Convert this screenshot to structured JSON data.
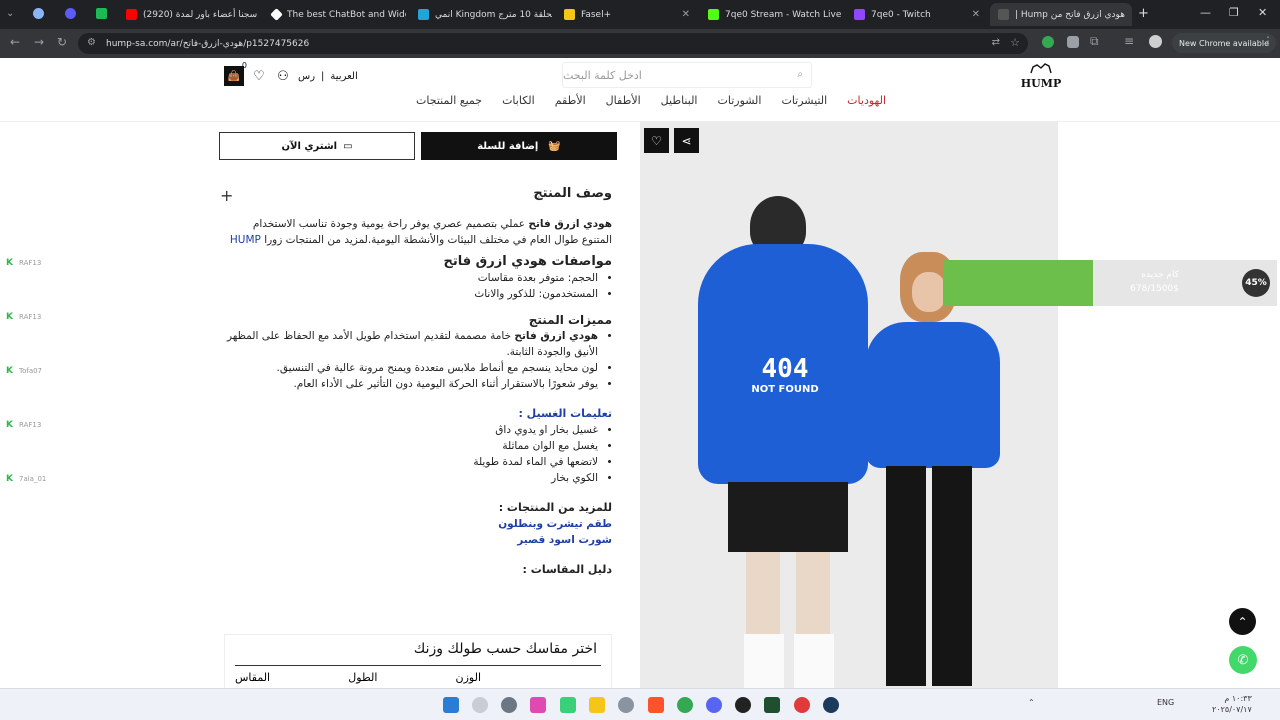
{
  "browser": {
    "tabs": [
      {
        "title": "(2920) سجنا أعضاء باور لمدة",
        "color": "#ff0000"
      },
      {
        "title": "The best ChatBot and Widg",
        "color": "#ffffff"
      },
      {
        "title": "انمي Kingdom الحلقة 10 مترج",
        "color": "#24a3d9"
      },
      {
        "title": "Fasel+",
        "color": "#f5c518"
      },
      {
        "title": "7qe0 Stream - Watch Live o",
        "color": "#53fc18"
      },
      {
        "title": "7qe0 - Twitch",
        "color": "#9146ff"
      },
      {
        "title": "هودي ازرق فاتح من Hump |",
        "color": "#555555"
      }
    ],
    "url": "hump-sa.com/ar/هودي-ازرق-فاتح/p1527475626",
    "new_chrome": "New Chrome available"
  },
  "store": {
    "logo": "HUMP",
    "search_placeholder": "ادخل كلمة البحث",
    "cart_count": "0",
    "lang": "العربية",
    "currency": "رس",
    "menu": [
      "الهوديات",
      "التيشرتات",
      "الشورتات",
      "البناطيل",
      "الأطفال",
      "الأطقم",
      "الكابات",
      "جميع المنتجات"
    ],
    "buy_now": "اشتري الآن",
    "add_to_cart": "إضافة للسلة"
  },
  "product": {
    "print_title": "404",
    "print_sub": "NOT FOUND",
    "desc_title": "وصف المنتج",
    "intro_bold": "هودي ازرق فاتح",
    "intro_rest": " عملي بتصميم عصري يوفر راحة يومية وجودة تناسب الاستخدام المتنوع طوال العام في مختلف البيئات والأنشطة اليومية.لمزيد من المنتجات زورا ",
    "intro_link": "HUMP",
    "specs_title": "مواصفات هودي ازرق فاتح",
    "specs": [
      "الحجم: متوفر بعدة مقاسات",
      "المستخدمون: للذكور والاناث"
    ],
    "features_title": "مميزات المنتج",
    "features_first_bold": "هودي ازرق فاتح",
    "features_first_rest": " خامة مصممة لتقديم استخدام طويل الأمد مع الحفاظ على المظهر الأنيق والجودة الثابتة.",
    "features": [
      "لون محايد ينسجم مع أنماط ملابس متعددة ويمنح مرونة عالية في التنسيق.",
      "يوفر شعورًا بالاستقرار أثناء الحركة اليومية دون التأثير على الأداء العام."
    ],
    "wash_title": "تعليمات الغسيل :",
    "wash": [
      "غسيل بخار او يدوي داڨ",
      "يغسل مع الوان مماثلة",
      "لاتضعها في الماء لمدة طويلة",
      "الكوي بخار"
    ],
    "more_title": "للمزيد من المنتجات :",
    "more_links": [
      "طقم تيشرت وبنطلون",
      "شورت اسود قصير"
    ],
    "size_guide": "دليل المقاسات :",
    "size_box_title": "اختر مقاسك حسب طولك وزنك",
    "size_cols": [
      "الوزن",
      "الطول",
      "المقاس"
    ]
  },
  "promo": {
    "title": "كام جديده",
    "progress": "678/1500$",
    "percent": "45%",
    "fill": 0.45
  },
  "sidebar": [
    "RAF13",
    "RAF13",
    "Tofa07",
    "RAF13",
    "7ala_01"
  ],
  "taskbar": {
    "lang": "ENG",
    "time": "١٠:٣٣ م",
    "date": "٢٠٢٥/٠٧/١٧"
  }
}
